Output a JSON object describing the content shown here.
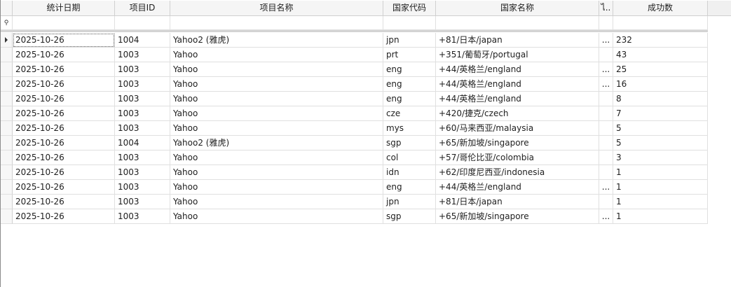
{
  "columns": [
    {
      "key": "indicator",
      "label": ""
    },
    {
      "key": "date",
      "label": "统计日期"
    },
    {
      "key": "project_id",
      "label": "项目ID"
    },
    {
      "key": "project_name",
      "label": "项目名称"
    },
    {
      "key": "country_code",
      "label": "国家代码"
    },
    {
      "key": "country_name",
      "label": "国家名称"
    },
    {
      "key": "extra",
      "label": "ไ.."
    },
    {
      "key": "success",
      "label": "成功数"
    }
  ],
  "filter_row_icon": "pin-icon",
  "rows": [
    {
      "date": "2025-10-26",
      "project_id": "1004",
      "project_name": "Yahoo2 (雅虎)",
      "country_code": "jpn",
      "country_name": "+81/日本/japan",
      "extra": "...",
      "success": "232"
    },
    {
      "date": "2025-10-26",
      "project_id": "1003",
      "project_name": "Yahoo",
      "country_code": "prt",
      "country_name": "+351/葡萄牙/portugal",
      "extra": "",
      "success": "43"
    },
    {
      "date": "2025-10-26",
      "project_id": "1003",
      "project_name": "Yahoo",
      "country_code": "eng",
      "country_name": "+44/英格兰/england",
      "extra": "...",
      "success": "25"
    },
    {
      "date": "2025-10-26",
      "project_id": "1003",
      "project_name": "Yahoo",
      "country_code": "eng",
      "country_name": "+44/英格兰/england",
      "extra": "...",
      "success": "16"
    },
    {
      "date": "2025-10-26",
      "project_id": "1003",
      "project_name": "Yahoo",
      "country_code": "eng",
      "country_name": "+44/英格兰/england",
      "extra": "",
      "success": "8"
    },
    {
      "date": "2025-10-26",
      "project_id": "1003",
      "project_name": "Yahoo",
      "country_code": "cze",
      "country_name": "+420/捷克/czech",
      "extra": "",
      "success": "7"
    },
    {
      "date": "2025-10-26",
      "project_id": "1003",
      "project_name": "Yahoo",
      "country_code": "mys",
      "country_name": "+60/马来西亚/malaysia",
      "extra": "",
      "success": "5"
    },
    {
      "date": "2025-10-26",
      "project_id": "1004",
      "project_name": "Yahoo2 (雅虎)",
      "country_code": "sgp",
      "country_name": "+65/新加坡/singapore",
      "extra": "",
      "success": "5"
    },
    {
      "date": "2025-10-26",
      "project_id": "1003",
      "project_name": "Yahoo",
      "country_code": "col",
      "country_name": "+57/哥伦比亚/colombia",
      "extra": "",
      "success": "3"
    },
    {
      "date": "2025-10-26",
      "project_id": "1003",
      "project_name": "Yahoo",
      "country_code": "idn",
      "country_name": "+62/印度尼西亚/indonesia",
      "extra": "",
      "success": "1"
    },
    {
      "date": "2025-10-26",
      "project_id": "1003",
      "project_name": "Yahoo",
      "country_code": "eng",
      "country_name": "+44/英格兰/england",
      "extra": "...",
      "success": "1"
    },
    {
      "date": "2025-10-26",
      "project_id": "1003",
      "project_name": "Yahoo",
      "country_code": "jpn",
      "country_name": "+81/日本/japan",
      "extra": "",
      "success": "1"
    },
    {
      "date": "2025-10-26",
      "project_id": "1003",
      "project_name": "Yahoo",
      "country_code": "sgp",
      "country_name": "+65/新加坡/singapore",
      "extra": "...",
      "success": "1"
    }
  ]
}
